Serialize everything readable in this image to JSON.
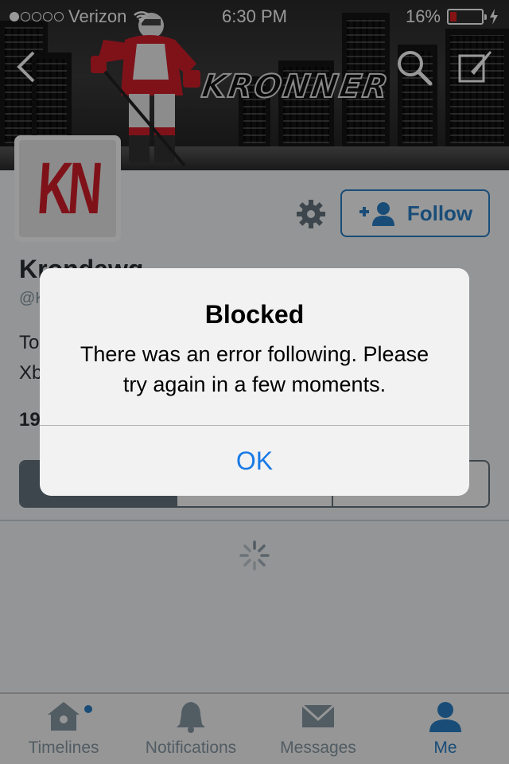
{
  "status_bar": {
    "carrier": "Verizon",
    "time": "6:30 PM",
    "battery": "16%",
    "battery_level": 0.16
  },
  "header": {
    "wordmark": "KRONNER",
    "icons": [
      "back-chevron-icon",
      "search-icon",
      "compose-icon"
    ]
  },
  "profile": {
    "avatar_text": "KN",
    "display_name": "Krondawg",
    "handle": "@K",
    "bio_lines": [
      "To",
      "Xb"
    ],
    "stats": "19",
    "follow_label": "Follow"
  },
  "dialog": {
    "title": "Blocked",
    "message": "There was an error following. Please try again in a few moments.",
    "button": "OK"
  },
  "tabs": [
    {
      "label": "Timelines",
      "icon": "home-icon"
    },
    {
      "label": "Notifications",
      "icon": "bell-icon"
    },
    {
      "label": "Messages",
      "icon": "envelope-icon"
    },
    {
      "label": "Me",
      "icon": "person-icon"
    }
  ],
  "colors": {
    "accent": "#2a80c8",
    "alert_button": "#1a7ae6",
    "tab_inactive": "#8899a6"
  }
}
